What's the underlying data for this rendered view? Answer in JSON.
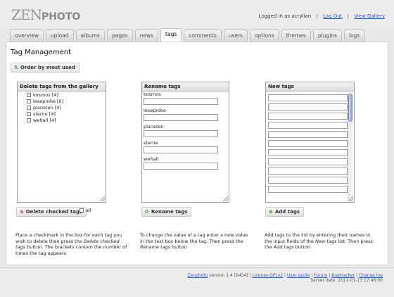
{
  "header": {
    "logo_zen": "ZEN",
    "logo_photo": "PHOTO",
    "logged_in_text": "Logged in as acrylian",
    "logout_label": "Log Out",
    "view_gallery_label": "View Gallery",
    "separator": "|"
  },
  "tabs": [
    {
      "label": "overview",
      "active": false
    },
    {
      "label": "upload",
      "active": false
    },
    {
      "label": "albums",
      "active": false
    },
    {
      "label": "pages",
      "active": false
    },
    {
      "label": "news",
      "active": false
    },
    {
      "label": "tags",
      "active": true
    },
    {
      "label": "comments",
      "active": false
    },
    {
      "label": "users",
      "active": false
    },
    {
      "label": "options",
      "active": false
    },
    {
      "label": "themes",
      "active": false
    },
    {
      "label": "plugins",
      "active": false
    },
    {
      "label": "logs",
      "active": false
    }
  ],
  "main": {
    "title": "Tag Management",
    "order_button_label": "Order by most used"
  },
  "delete_panel": {
    "header": "Delete tags from the gallery",
    "tags": [
      {
        "label": "kosmos [4]"
      },
      {
        "label": "leseprobe [0]"
      },
      {
        "label": "planeten [4]"
      },
      {
        "label": "sterne [4]"
      },
      {
        "label": "weltall [4]"
      }
    ],
    "button_label": "Delete checked tags",
    "all_label": "all",
    "desc_1": "Place a checkmark in the box for each tag you wish to delete then press the",
    "desc_em": "Delete checked tags",
    "desc_2": "button. The brackets contain the number of times the tag appears."
  },
  "rename_panel": {
    "header": "Rename tags",
    "items": [
      {
        "label": "kosmos",
        "value": ""
      },
      {
        "label": "leseprobe",
        "value": ""
      },
      {
        "label": "planeten",
        "value": ""
      },
      {
        "label": "sterne",
        "value": ""
      },
      {
        "label": "weltall",
        "value": ""
      }
    ],
    "button_label": "Rename tags",
    "desc_1": "To change the value of a tag enter a new value in the text box below the tag. Then press the",
    "desc_em": "Rename tags",
    "desc_2": "button"
  },
  "new_panel": {
    "header": "New tags",
    "button_label": "Add tags",
    "desc_1": "Add tags to the list by entering their names in the input fields of the",
    "desc_em": "New tags",
    "desc_2": "list. Then press the",
    "desc_em2": "Add tags",
    "desc_3": "button"
  },
  "footer": {
    "brand": "Zenphoto",
    "version": "version 1.4 [6454]",
    "license": "License:GPLv2",
    "user_guide": "User guide",
    "forum": "Forum",
    "bugtracker": "Bugtracker",
    "changelog": "Change log",
    "server_date": "Server date: 2011-01-13 17:46:00",
    "sep": "|"
  },
  "colors": {
    "link": "#3355aa",
    "delete_icon": "#d0352b",
    "ok_icon": "#2a9a2a"
  },
  "icons": {
    "order": "sort-icon",
    "delete": "delete-icon",
    "rename": "check-icon",
    "add": "add-icon"
  }
}
